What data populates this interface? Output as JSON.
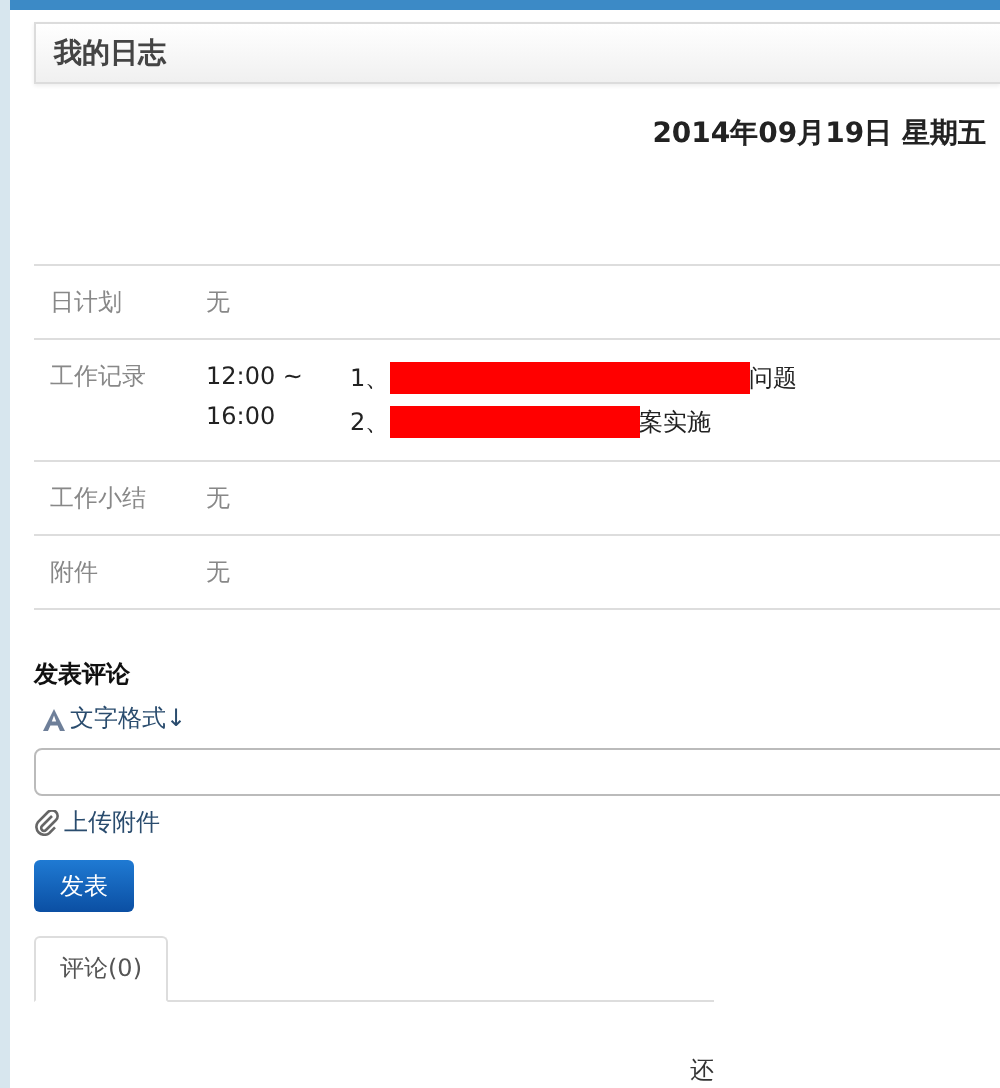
{
  "panel": {
    "title": "我的日志"
  },
  "date": "2014年09月19日 星期五",
  "rows": [
    {
      "kind": "plain",
      "label": "日计划",
      "value": "无"
    },
    {
      "kind": "log",
      "label": "工作记录",
      "times": [
        "12:00 ~",
        "16:00"
      ],
      "entries": [
        {
          "parts": [
            {
              "kind": "text",
              "text": "1、"
            },
            {
              "kind": "redacted"
            },
            {
              "kind": "text",
              "text": "问题"
            }
          ]
        },
        {
          "parts": [
            {
              "kind": "text",
              "text": "2、"
            },
            {
              "kind": "redacted"
            },
            {
              "kind": "text",
              "text": "案实施"
            }
          ]
        }
      ]
    },
    {
      "kind": "plain",
      "label": "工作小结",
      "value": "无"
    },
    {
      "kind": "plain",
      "label": "附件",
      "value": "无"
    }
  ],
  "comment": {
    "heading": "发表评论",
    "format_link": "文字格式↓",
    "upload_link": "上传附件",
    "submit": "发表"
  },
  "tabs": [
    {
      "label": "评论(0)",
      "selected": true
    }
  ],
  "footer_text": "还"
}
